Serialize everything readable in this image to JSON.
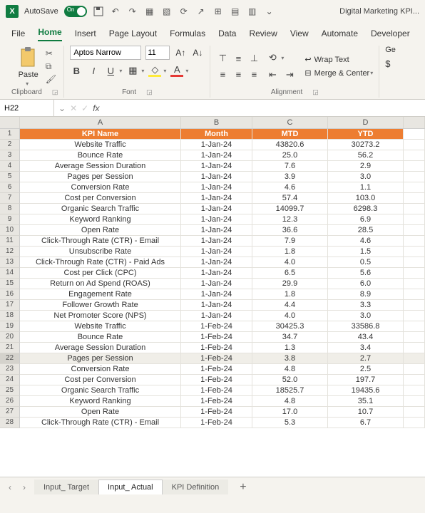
{
  "titlebar": {
    "autosave": "AutoSave",
    "autosave_on": "On",
    "doc_title": "Digital Marketing KPI..."
  },
  "tabs": [
    "File",
    "Home",
    "Insert",
    "Page Layout",
    "Formulas",
    "Data",
    "Review",
    "View",
    "Automate",
    "Developer"
  ],
  "active_tab": "Home",
  "clipboard": {
    "paste": "Paste",
    "label": "Clipboard"
  },
  "font": {
    "name": "Aptos Narrow",
    "size": "11",
    "label": "Font"
  },
  "alignment": {
    "wrap": "Wrap Text",
    "merge": "Merge & Center",
    "label": "Alignment"
  },
  "number": {
    "general": "Ge",
    "currency": "$"
  },
  "namebox": "H22",
  "formula": "",
  "columns": [
    "",
    "A",
    "B",
    "C",
    "D",
    ""
  ],
  "header_row": [
    "KPI Name",
    "Month",
    "MTD",
    "YTD"
  ],
  "selected_row": 22,
  "rows": [
    {
      "n": 2,
      "a": "Website Traffic",
      "b": "1-Jan-24",
      "c": "43820.6",
      "d": "30273.2"
    },
    {
      "n": 3,
      "a": "Bounce Rate",
      "b": "1-Jan-24",
      "c": "25.0",
      "d": "56.2"
    },
    {
      "n": 4,
      "a": "Average Session Duration",
      "b": "1-Jan-24",
      "c": "7.6",
      "d": "2.9"
    },
    {
      "n": 5,
      "a": "Pages per Session",
      "b": "1-Jan-24",
      "c": "3.9",
      "d": "3.0"
    },
    {
      "n": 6,
      "a": "Conversion Rate",
      "b": "1-Jan-24",
      "c": "4.6",
      "d": "1.1"
    },
    {
      "n": 7,
      "a": "Cost per Conversion",
      "b": "1-Jan-24",
      "c": "57.4",
      "d": "103.0"
    },
    {
      "n": 8,
      "a": "Organic Search Traffic",
      "b": "1-Jan-24",
      "c": "14099.7",
      "d": "6298.3"
    },
    {
      "n": 9,
      "a": "Keyword Ranking",
      "b": "1-Jan-24",
      "c": "12.3",
      "d": "6.9"
    },
    {
      "n": 10,
      "a": "Open Rate",
      "b": "1-Jan-24",
      "c": "36.6",
      "d": "28.5"
    },
    {
      "n": 11,
      "a": "Click-Through Rate (CTR) - Email",
      "b": "1-Jan-24",
      "c": "7.9",
      "d": "4.6"
    },
    {
      "n": 12,
      "a": "Unsubscribe Rate",
      "b": "1-Jan-24",
      "c": "1.8",
      "d": "1.5"
    },
    {
      "n": 13,
      "a": "Click-Through Rate (CTR) - Paid Ads",
      "b": "1-Jan-24",
      "c": "4.0",
      "d": "0.5"
    },
    {
      "n": 14,
      "a": "Cost per Click (CPC)",
      "b": "1-Jan-24",
      "c": "6.5",
      "d": "5.6"
    },
    {
      "n": 15,
      "a": "Return on Ad Spend (ROAS)",
      "b": "1-Jan-24",
      "c": "29.9",
      "d": "6.0"
    },
    {
      "n": 16,
      "a": "Engagement Rate",
      "b": "1-Jan-24",
      "c": "1.8",
      "d": "8.9"
    },
    {
      "n": 17,
      "a": "Follower Growth Rate",
      "b": "1-Jan-24",
      "c": "4.4",
      "d": "3.3"
    },
    {
      "n": 18,
      "a": "Net Promoter Score (NPS)",
      "b": "1-Jan-24",
      "c": "4.0",
      "d": "3.0"
    },
    {
      "n": 19,
      "a": "Website Traffic",
      "b": "1-Feb-24",
      "c": "30425.3",
      "d": "33586.8"
    },
    {
      "n": 20,
      "a": "Bounce Rate",
      "b": "1-Feb-24",
      "c": "34.7",
      "d": "43.4"
    },
    {
      "n": 21,
      "a": "Average Session Duration",
      "b": "1-Feb-24",
      "c": "1.3",
      "d": "3.4"
    },
    {
      "n": 22,
      "a": "Pages per Session",
      "b": "1-Feb-24",
      "c": "3.8",
      "d": "2.7"
    },
    {
      "n": 23,
      "a": "Conversion Rate",
      "b": "1-Feb-24",
      "c": "4.8",
      "d": "2.5"
    },
    {
      "n": 24,
      "a": "Cost per Conversion",
      "b": "1-Feb-24",
      "c": "52.0",
      "d": "197.7"
    },
    {
      "n": 25,
      "a": "Organic Search Traffic",
      "b": "1-Feb-24",
      "c": "18525.7",
      "d": "19435.6"
    },
    {
      "n": 26,
      "a": "Keyword Ranking",
      "b": "1-Feb-24",
      "c": "4.8",
      "d": "35.1"
    },
    {
      "n": 27,
      "a": "Open Rate",
      "b": "1-Feb-24",
      "c": "17.0",
      "d": "10.7"
    },
    {
      "n": 28,
      "a": "Click-Through Rate (CTR) - Email",
      "b": "1-Feb-24",
      "c": "5.3",
      "d": "6.7"
    }
  ],
  "sheet_tabs": [
    "Input_ Target",
    "Input_ Actual",
    "KPI Definition"
  ],
  "active_sheet": "Input_ Actual"
}
